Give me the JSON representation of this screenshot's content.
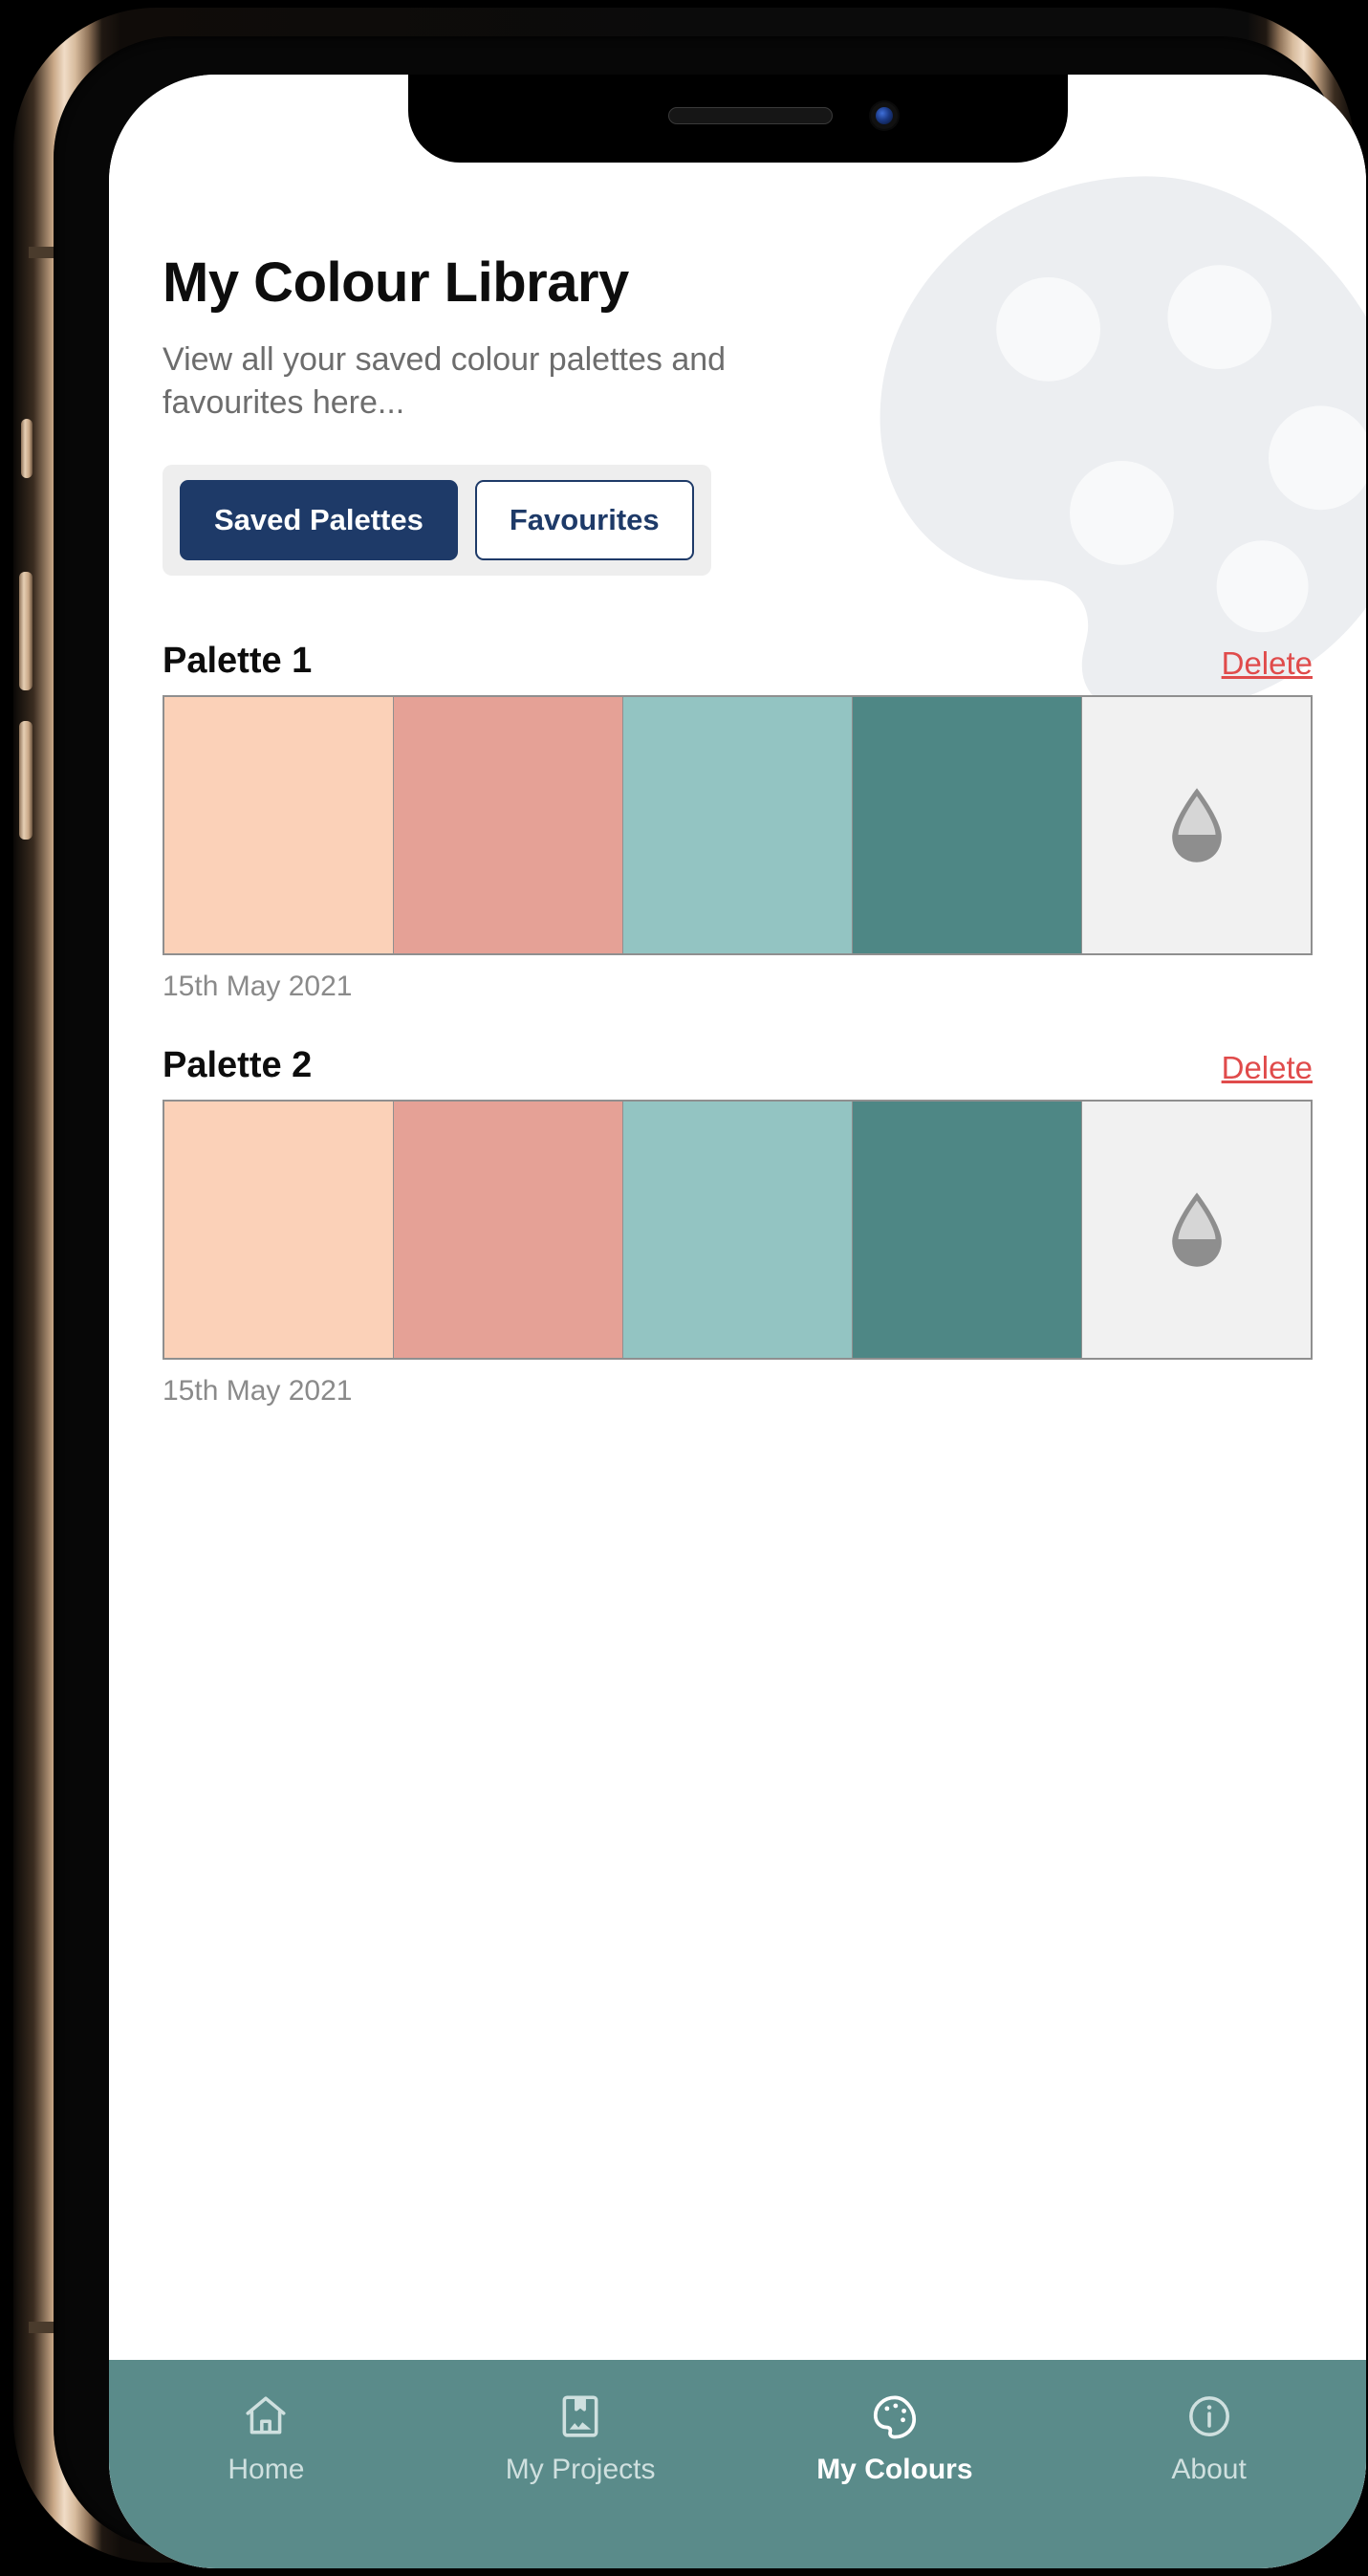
{
  "app": {
    "title": "My Colour Library",
    "subtitle": "View all your saved colour palettes and favourites here..."
  },
  "tabs": [
    {
      "label": "Saved Palettes",
      "active": true
    },
    {
      "label": "Favourites",
      "active": false
    }
  ],
  "palettes": [
    {
      "name": "Palette 1",
      "delete_label": "Delete",
      "date": "15th May 2021",
      "colors": [
        "#fbd1b8",
        "#e5a196",
        "#93c4c2",
        "#4e8785",
        "#f1f1f1"
      ],
      "drop_icon": "water-drop-icon"
    },
    {
      "name": "Palette 2",
      "delete_label": "Delete",
      "date": "15th May 2021",
      "colors": [
        "#fbd1b8",
        "#e5a196",
        "#93c4c2",
        "#4e8785",
        "#f1f1f1"
      ],
      "drop_icon": "water-drop-icon"
    }
  ],
  "bottom_nav": [
    {
      "label": "Home",
      "icon": "home-icon",
      "active": false
    },
    {
      "label": "My Projects",
      "icon": "artwork-frame-icon",
      "active": false
    },
    {
      "label": "My Colours",
      "icon": "palette-icon",
      "active": true
    },
    {
      "label": "About",
      "icon": "info-circle-icon",
      "active": false
    }
  ],
  "colors": {
    "accent_navy": "#1e3a68",
    "nav_teal": "#5a8b8a",
    "delete_red": "#e04b4b",
    "tab_track": "#eeeeee",
    "watermark": "#eceef1"
  },
  "device": {
    "notch_speaker": "speaker-grille",
    "notch_camera": "front-camera"
  }
}
